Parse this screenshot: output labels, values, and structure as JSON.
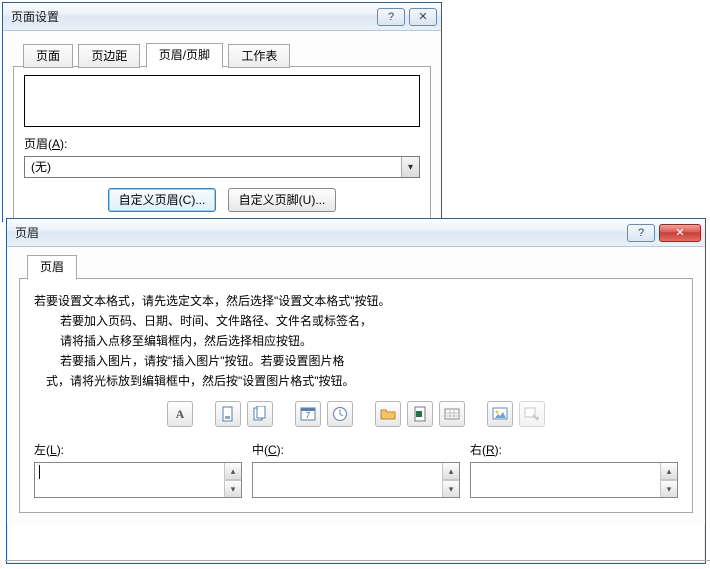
{
  "dlg1": {
    "title": "页面设置",
    "help_glyph": "?",
    "close_glyph": "✕",
    "tabs": {
      "page": "页面",
      "margin": "页边距",
      "hf": "页眉/页脚",
      "sheet": "工作表"
    },
    "header_label_prefix": "页眉(",
    "header_label_ul": "A",
    "header_label_suffix": "):",
    "combo_value": "(无)",
    "combo_chevron": "▾",
    "custom_header": "自定义页眉(C)...",
    "custom_footer": "自定义页脚(U)..."
  },
  "dlg2": {
    "title": "页眉",
    "help_glyph": "?",
    "close_glyph": "✕",
    "tab_label": "页眉",
    "instr": {
      "l1": "若要设置文本格式，请先选定文本，然后选择\"设置文本格式\"按钮。",
      "l2": "若要加入页码、日期、时间、文件路径、文件名或标签名，",
      "l3": "请将插入点移至编辑框内，然后选择相应按钮。",
      "l4": "若要插入图片，请按\"插入图片\"按钮。若要设置图片格",
      "l5": "式，请将光标放到编辑框中，然后按\"设置图片格式\"按钮。"
    },
    "toolbar_text_a": "A",
    "left_label_prefix": "左(",
    "left_label_ul": "L",
    "left_label_suffix": "):",
    "center_label_prefix": "中(",
    "center_label_ul": "C",
    "center_label_suffix": "):",
    "right_label_prefix": "右(",
    "right_label_ul": "R",
    "right_label_suffix": "):",
    "scroll_up": "▴",
    "scroll_down": "▾"
  }
}
